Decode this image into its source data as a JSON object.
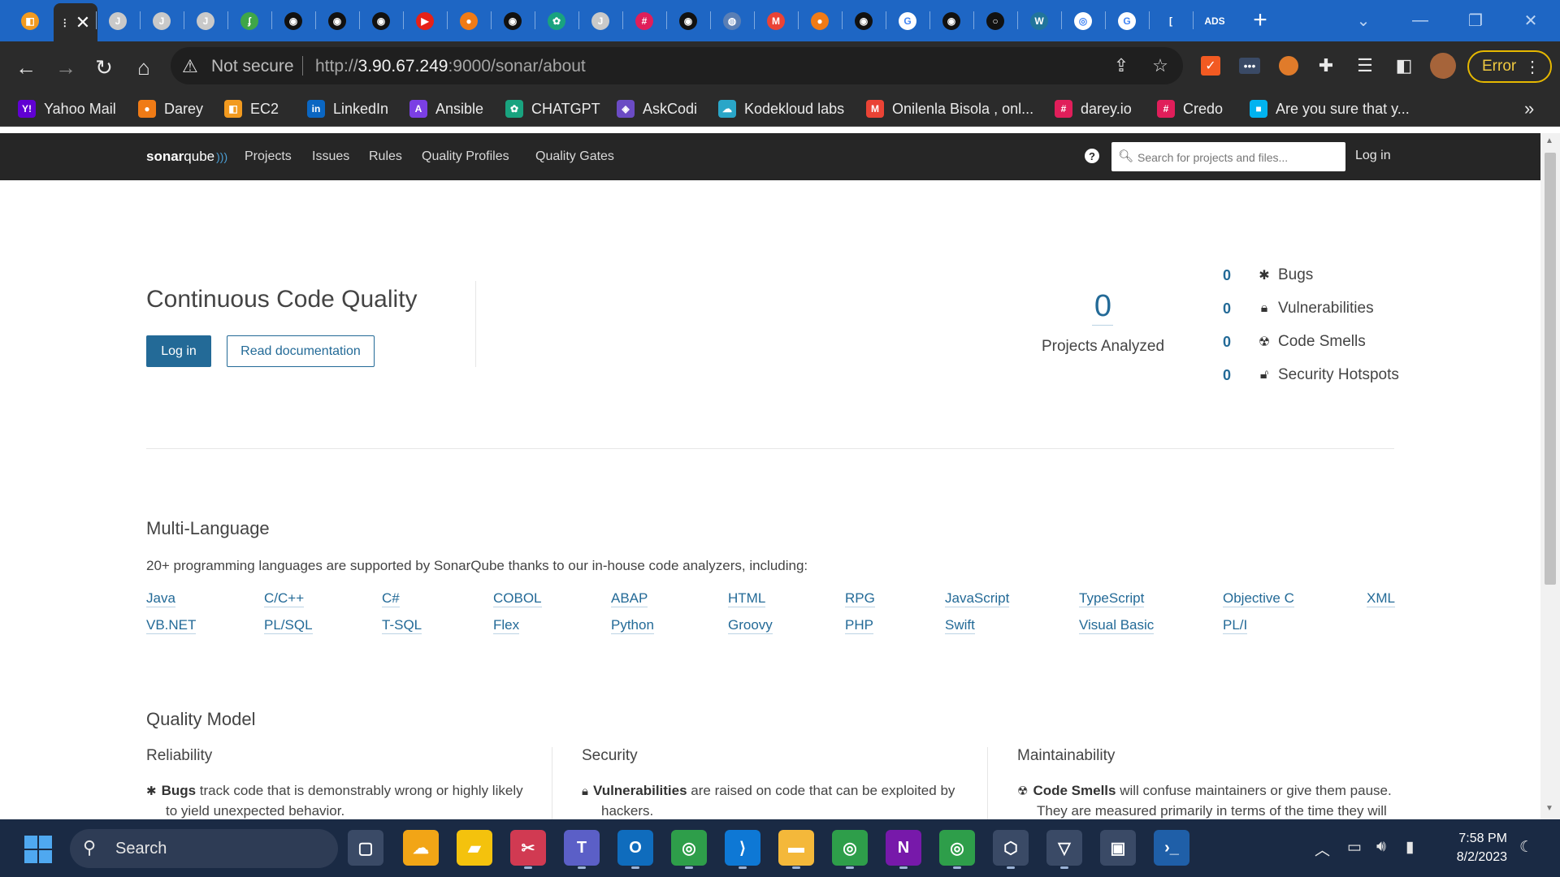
{
  "browser": {
    "tabs": [
      {
        "icon": "app-icon",
        "color": "#f29a1f",
        "glyph": "◧"
      },
      {
        "icon": "active-tab-close",
        "color": "#2b2b2b",
        "glyph": "⋮"
      },
      {
        "icon": "jenkins-icon",
        "color": "#c9c9c9",
        "glyph": "J"
      },
      {
        "icon": "jenkins-icon",
        "color": "#c9c9c9",
        "glyph": "J"
      },
      {
        "icon": "jenkins-icon",
        "color": "#c9c9c9",
        "glyph": "J"
      },
      {
        "icon": "jfrog-icon",
        "color": "#3fa648",
        "glyph": "ʄ"
      },
      {
        "icon": "github-icon",
        "color": "#111111",
        "glyph": "◉"
      },
      {
        "icon": "github-icon",
        "color": "#111111",
        "glyph": "◉"
      },
      {
        "icon": "github-icon",
        "color": "#111111",
        "glyph": "◉"
      },
      {
        "icon": "youtube-icon",
        "color": "#e62117",
        "glyph": "▶"
      },
      {
        "icon": "darey-icon",
        "color": "#f07b16",
        "glyph": "●"
      },
      {
        "icon": "github-icon",
        "color": "#111111",
        "glyph": "◉"
      },
      {
        "icon": "chatgpt-icon",
        "color": "#19a37f",
        "glyph": "✿"
      },
      {
        "icon": "jenkins-icon",
        "color": "#c9c9c9",
        "glyph": "J"
      },
      {
        "icon": "slack-icon",
        "color": "#e01e5a",
        "glyph": "#"
      },
      {
        "icon": "github-icon",
        "color": "#111111",
        "glyph": "◉"
      },
      {
        "icon": "globe-icon",
        "color": "#5a7fb5",
        "glyph": "◍"
      },
      {
        "icon": "gmail-icon",
        "color": "#ea4335",
        "glyph": "M"
      },
      {
        "icon": "darey-icon",
        "color": "#f07b16",
        "glyph": "●"
      },
      {
        "icon": "github-icon",
        "color": "#111111",
        "glyph": "◉"
      },
      {
        "icon": "google-icon",
        "color": "#ffffff",
        "glyph": "G"
      },
      {
        "icon": "github-icon",
        "color": "#111111",
        "glyph": "◉"
      },
      {
        "icon": "circle-icon",
        "color": "#111111",
        "glyph": "○"
      },
      {
        "icon": "wordpress-icon",
        "color": "#21759b",
        "glyph": "W"
      },
      {
        "icon": "chrome-icon",
        "color": "#ffffff",
        "glyph": "◎"
      },
      {
        "icon": "google-icon",
        "color": "#ffffff",
        "glyph": "G"
      },
      {
        "icon": "bracket-icon",
        "color": "#1e66c4",
        "glyph": "["
      },
      {
        "icon": "ads-icon",
        "color": "#1e66c4",
        "glyph": "ADS"
      }
    ],
    "address": {
      "security_label": "Not secure",
      "url_scheme": "http://",
      "url_host": "3.90.67.249",
      "url_rest": ":9000/sonar/about"
    },
    "profile_button": "Error",
    "bookmarks": [
      {
        "label": "Yahoo Mail",
        "color": "#6001d2",
        "glyph": "Y!"
      },
      {
        "label": "Darey",
        "color": "#f07b16",
        "glyph": "●"
      },
      {
        "label": "EC2",
        "color": "#f29a1f",
        "glyph": "◧"
      },
      {
        "label": "LinkedIn",
        "color": "#0a66c2",
        "glyph": "in"
      },
      {
        "label": "Ansible",
        "color": "#7b3fe4",
        "glyph": "A"
      },
      {
        "label": "CHATGPT",
        "color": "#19a37f",
        "glyph": "✿"
      },
      {
        "label": "AskCodi",
        "color": "#6b4bc4",
        "glyph": "◈"
      },
      {
        "label": "Kodekloud labs",
        "color": "#2aa6c8",
        "glyph": "☁"
      },
      {
        "label": "Onilenla Bisola , onl...",
        "color": "#ea4335",
        "glyph": "M"
      },
      {
        "label": "darey.io",
        "color": "#e01e5a",
        "glyph": "#"
      },
      {
        "label": "Credo",
        "color": "#e01e5a",
        "glyph": "#"
      },
      {
        "label": "Are you sure that y...",
        "color": "#00b3f0",
        "glyph": "■"
      }
    ]
  },
  "sonar": {
    "logo_bold": "sonar",
    "logo_light": "qube",
    "nav": [
      "Projects",
      "Issues",
      "Rules",
      "Quality Profiles",
      "Quality Gates"
    ],
    "search_placeholder": "Search for projects and files...",
    "login": "Log in"
  },
  "hero": {
    "title": "Continuous Code Quality",
    "login_button": "Log in",
    "docs_button": "Read documentation",
    "projects_count": "0",
    "projects_label": "Projects Analyzed",
    "metrics": [
      {
        "value": "0",
        "label": "Bugs",
        "icon": "bug-icon",
        "glyph": "✱"
      },
      {
        "value": "0",
        "label": "Vulnerabilities",
        "icon": "lock-icon",
        "glyph": "🔒︎"
      },
      {
        "value": "0",
        "label": "Code Smells",
        "icon": "code-smell-icon",
        "glyph": "☢"
      },
      {
        "value": "0",
        "label": "Security Hotspots",
        "icon": "hotspot-icon",
        "glyph": "🔓︎"
      }
    ]
  },
  "multi_language": {
    "title": "Multi-Language",
    "intro": "20+ programming languages are supported by SonarQube thanks to our in-house code analyzers, including:",
    "row1": [
      "Java",
      "C/C++",
      "C#",
      "COBOL",
      "ABAP",
      "HTML",
      "RPG",
      "JavaScript",
      "TypeScript",
      "Objective C",
      "XML"
    ],
    "row2": [
      "VB.NET",
      "PL/SQL",
      "T-SQL",
      "Flex",
      "Python",
      "Groovy",
      "PHP",
      "Swift",
      "Visual Basic",
      "PL/I"
    ]
  },
  "quality_model": {
    "title": "Quality Model",
    "columns": [
      {
        "heading": "Reliability",
        "term": "Bugs",
        "text_line1": " track code that is demonstrably wrong or highly likely",
        "text_line2": "to yield unexpected behavior.",
        "icon": "bug-icon",
        "glyph": "✱"
      },
      {
        "heading": "Security",
        "term": "Vulnerabilities",
        "text_line1": " are raised on code that can be exploited by",
        "text_line2": "hackers.",
        "icon": "lock-icon",
        "glyph": "🔒︎"
      },
      {
        "heading": "Maintainability",
        "term": "Code Smells",
        "text_line1": " will confuse maintainers or give them pause.",
        "text_line2": "They are measured primarily in terms of the time they will",
        "icon": "code-smell-icon",
        "glyph": "☢"
      }
    ]
  },
  "taskbar": {
    "search_label": "Search",
    "time": "7:58 PM",
    "date": "8/2/2023",
    "apps": [
      {
        "name": "task-view-icon",
        "color": "#3a4a66",
        "glyph": "▢"
      },
      {
        "name": "weather-icon",
        "color": "#f2a516",
        "glyph": "☁"
      },
      {
        "name": "sticky-notes-icon",
        "color": "#f4c20d",
        "glyph": "▰"
      },
      {
        "name": "snipping-tool-icon",
        "color": "#d13a52",
        "glyph": "✂"
      },
      {
        "name": "teams-icon",
        "color": "#5b5fc7",
        "glyph": "T"
      },
      {
        "name": "outlook-icon",
        "color": "#0f6cbd",
        "glyph": "O"
      },
      {
        "name": "chrome-icon",
        "color": "#2e9e4a",
        "glyph": "◎"
      },
      {
        "name": "vscode-icon",
        "color": "#0e78d5",
        "glyph": "⟩"
      },
      {
        "name": "file-explorer-icon",
        "color": "#f4b83a",
        "glyph": "▬"
      },
      {
        "name": "chrome-icon",
        "color": "#2e9e4a",
        "glyph": "◎"
      },
      {
        "name": "onenote-icon",
        "color": "#7719aa",
        "glyph": "N"
      },
      {
        "name": "chrome-icon",
        "color": "#2e9e4a",
        "glyph": "◎"
      },
      {
        "name": "virtualbox-icon",
        "color": "#3a4a66",
        "glyph": "⬡"
      },
      {
        "name": "vpn-icon",
        "color": "#3a4a66",
        "glyph": "▽"
      },
      {
        "name": "photos-icon",
        "color": "#3a4a66",
        "glyph": "▣"
      },
      {
        "name": "powershell-icon",
        "color": "#1f5fa8",
        "glyph": "›_"
      }
    ]
  }
}
